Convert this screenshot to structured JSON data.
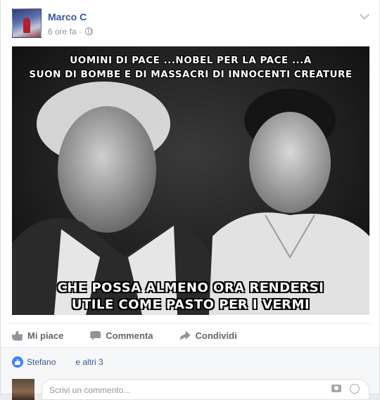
{
  "post": {
    "author": "Marco C",
    "timestamp": "6 ore fa",
    "separator": "·"
  },
  "image": {
    "top_text_line1": "UOMINI DI PACE ...NOBEL PER LA PACE ...A",
    "top_text_line2": "SUON DI BOMBE E DI MASSACRI DI INNOCENTI CREATURE",
    "bottom_text_line1": "CHE POSSA ALMENO ORA RENDERSI",
    "bottom_text_line2": "UTILE COME PASTO PER I VERMI"
  },
  "actions": {
    "like_label": "Mi piace",
    "comment_label": "Commenta",
    "share_label": "Condividi"
  },
  "reactions": {
    "name_prefix": "Stefano",
    "suffix": "e altri 3"
  },
  "comment_box": {
    "placeholder": "Scrivi un commento..."
  },
  "colors": {
    "link": "#365899",
    "like_blue": "#4080ff"
  }
}
